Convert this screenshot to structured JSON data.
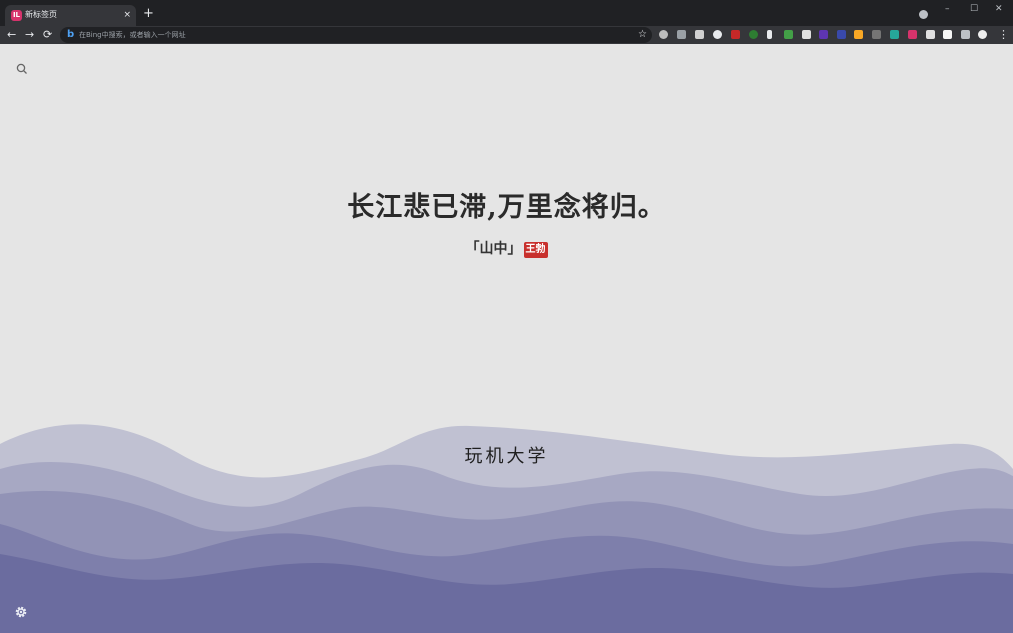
{
  "browser": {
    "tab": {
      "title": "新标签页",
      "icon_letter": "IL",
      "close": "×"
    },
    "new_tab": "+",
    "window_controls": {
      "minimize": "–",
      "maximize": "☐",
      "close": "✕"
    },
    "nav": {
      "back": "←",
      "forward": "→",
      "reload": "⟳"
    },
    "omnibox": {
      "engine_icon": "b",
      "placeholder": "在Bing中搜索，或者输入一个网址"
    },
    "bookmark_star": "☆",
    "menu": "⋮",
    "extension_icons": [
      "circle-icon",
      "shield-icon",
      "image-icon",
      "globe-icon",
      "red-bird-icon",
      "green-leaf-icon",
      "x-icon",
      "gem-icon",
      "purple-icon",
      "box-icon",
      "ia-icon",
      "yellow-icon",
      "copy-icon",
      "s-icon",
      "il-icon",
      "grid-icon",
      "c-icon",
      "puzzle-icon",
      "avatar-icon"
    ]
  },
  "page": {
    "poem_line": "长江悲已滞,万里念将归。",
    "poem_title": "「山中」",
    "poem_author": "王勃",
    "site_name": "玩机大学"
  },
  "colors": {
    "page_bg": "#e5e5e5",
    "wave_light": "#c0c1d2",
    "wave_mid": "#9293b6",
    "wave_dark": "#6b6c9f",
    "author_badge": "#c8302d"
  }
}
